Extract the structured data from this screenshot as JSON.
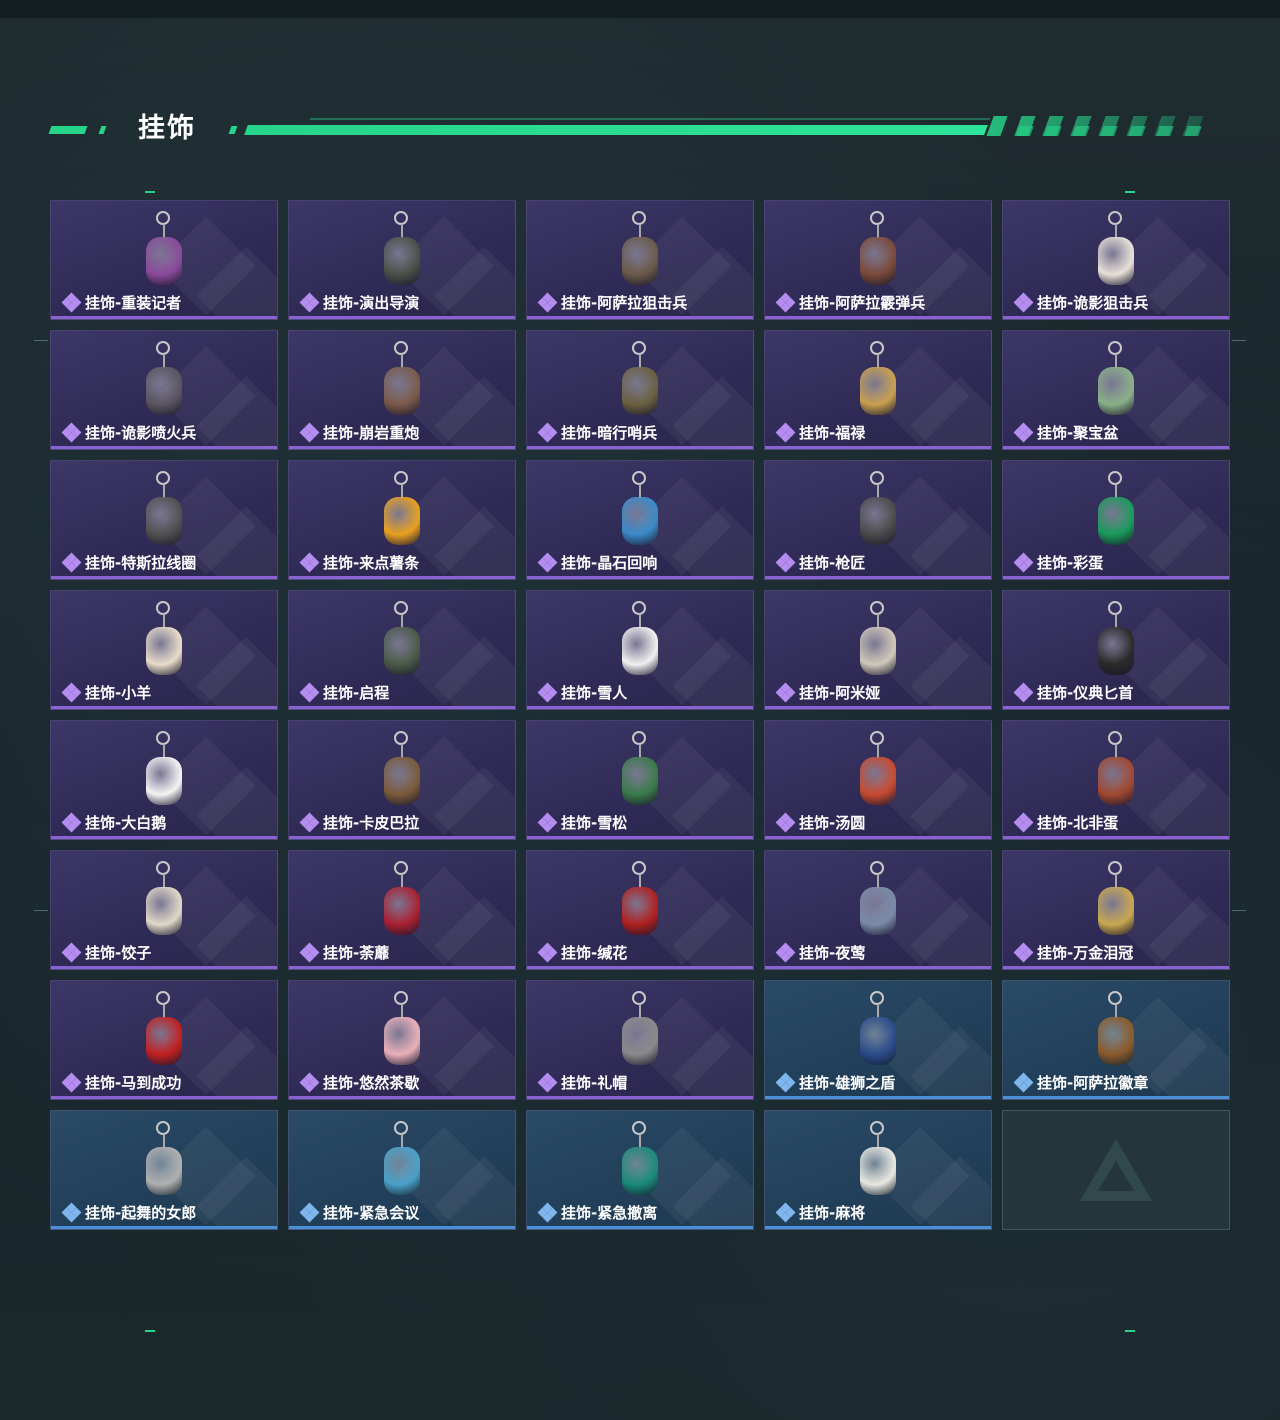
{
  "section": {
    "title": "挂饰"
  },
  "colors": {
    "accent": "#27d58a",
    "purple_rarity": "#8a63d2",
    "blue_rarity": "#4b8fd6"
  },
  "items": [
    {
      "name": "挂饰-重装记者",
      "rarity": "purple",
      "color": "#8a4a9a"
    },
    {
      "name": "挂饰-演出导演",
      "rarity": "purple",
      "color": "#4a5048"
    },
    {
      "name": "挂饰-阿萨拉狙击兵",
      "rarity": "purple",
      "color": "#6a5a48"
    },
    {
      "name": "挂饰-阿萨拉霰弹兵",
      "rarity": "purple",
      "color": "#7a4a3a"
    },
    {
      "name": "挂饰-诡影狙击兵",
      "rarity": "purple",
      "color": "#e8e0d8"
    },
    {
      "name": "挂饰-诡影喷火兵",
      "rarity": "purple",
      "color": "#5a5560"
    },
    {
      "name": "挂饰-崩岩重炮",
      "rarity": "purple",
      "color": "#7a5a4a"
    },
    {
      "name": "挂饰-暗行哨兵",
      "rarity": "purple",
      "color": "#6a6040"
    },
    {
      "name": "挂饰-福禄",
      "rarity": "purple",
      "color": "#c8a050"
    },
    {
      "name": "挂饰-聚宝盆",
      "rarity": "purple",
      "color": "#8ab088"
    },
    {
      "name": "挂饰-特斯拉线圈",
      "rarity": "purple",
      "color": "#505050"
    },
    {
      "name": "挂饰-来点薯条",
      "rarity": "purple",
      "color": "#e8a020"
    },
    {
      "name": "挂饰-晶石回响",
      "rarity": "purple",
      "color": "#3a8ac8"
    },
    {
      "name": "挂饰-枪匠",
      "rarity": "purple",
      "color": "#4a4a4a"
    },
    {
      "name": "挂饰-彩蛋",
      "rarity": "purple",
      "color": "#1a9a5a"
    },
    {
      "name": "挂饰-小羊",
      "rarity": "purple",
      "color": "#e8dcc8"
    },
    {
      "name": "挂饰-启程",
      "rarity": "purple",
      "color": "#4a5a48"
    },
    {
      "name": "挂饰-雪人",
      "rarity": "purple",
      "color": "#f0f0f0"
    },
    {
      "name": "挂饰-阿米娅",
      "rarity": "purple",
      "color": "#d0c8b8"
    },
    {
      "name": "挂饰-仪典匕首",
      "rarity": "purple",
      "color": "#2a2a2a"
    },
    {
      "name": "挂饰-大白鹅",
      "rarity": "purple",
      "color": "#f4f4f4"
    },
    {
      "name": "挂饰-卡皮巴拉",
      "rarity": "purple",
      "color": "#7a5a3a"
    },
    {
      "name": "挂饰-雪松",
      "rarity": "purple",
      "color": "#3a7a4a"
    },
    {
      "name": "挂饰-汤圆",
      "rarity": "purple",
      "color": "#c84a30"
    },
    {
      "name": "挂饰-北非蛋",
      "rarity": "purple",
      "color": "#a04830"
    },
    {
      "name": "挂饰-饺子",
      "rarity": "purple",
      "color": "#e0d8c8"
    },
    {
      "name": "挂饰-荼蘼",
      "rarity": "purple",
      "color": "#a82030"
    },
    {
      "name": "挂饰-缄花",
      "rarity": "purple",
      "color": "#b02020"
    },
    {
      "name": "挂饰-夜莺",
      "rarity": "purple",
      "color": "#7a8aa8"
    },
    {
      "name": "挂饰-万金泪冠",
      "rarity": "purple",
      "color": "#c8a850"
    },
    {
      "name": "挂饰-马到成功",
      "rarity": "purple",
      "color": "#c02020"
    },
    {
      "name": "挂饰-悠然茶歇",
      "rarity": "purple",
      "color": "#e8b0b8"
    },
    {
      "name": "挂饰-礼帽",
      "rarity": "purple",
      "color": "#8a8a8a"
    },
    {
      "name": "挂饰-雄狮之盾",
      "rarity": "blue",
      "color": "#2a4a8a"
    },
    {
      "name": "挂饰-阿萨拉徽章",
      "rarity": "blue",
      "color": "#8a5a2a"
    },
    {
      "name": "挂饰-起舞的女郎",
      "rarity": "blue",
      "color": "#b0b0b0"
    },
    {
      "name": "挂饰-紧急会议",
      "rarity": "blue",
      "color": "#4aa0c8"
    },
    {
      "name": "挂饰-紧急撤离",
      "rarity": "blue",
      "color": "#1a8a7a"
    },
    {
      "name": "挂饰-麻将",
      "rarity": "blue",
      "color": "#e8e8e0"
    }
  ]
}
